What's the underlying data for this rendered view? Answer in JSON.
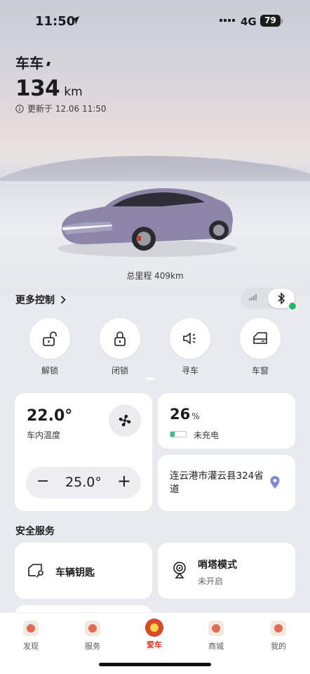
{
  "status_bar": {
    "time": "11:50",
    "network": "4G",
    "battery": "79"
  },
  "vehicle": {
    "name": "车车",
    "range_value": "134",
    "range_unit": "km",
    "updated": "更新于 12.06 11:50",
    "odometer": "总里程 409km"
  },
  "more_controls": {
    "label": "更多控制"
  },
  "quick_controls": [
    {
      "label": "解锁",
      "icon": "unlock-icon"
    },
    {
      "label": "闭锁",
      "icon": "lock-icon"
    },
    {
      "label": "寻车",
      "icon": "horn-icon"
    },
    {
      "label": "车窗",
      "icon": "window-icon"
    }
  ],
  "climate": {
    "inside_temp": "22.0°",
    "inside_label": "车内温度",
    "set_temp": "25.0°"
  },
  "battery_card": {
    "percent": "26",
    "unit": "%",
    "level": 0.26,
    "status": "未充电",
    "accent": "#2fc38a"
  },
  "location_card": {
    "address": "连云港市灌云县324省道"
  },
  "safety": {
    "title": "安全服务",
    "key_label": "车辆钥匙",
    "sentry_label": "哨塔模式",
    "sentry_status": "未开启"
  },
  "tabs": [
    {
      "label": "发现"
    },
    {
      "label": "服务"
    },
    {
      "label": "爱车",
      "active": true
    },
    {
      "label": "商城"
    },
    {
      "label": "我的"
    }
  ],
  "colors": {
    "brand_red": "#d23a1e",
    "connected_green": "#27b36b"
  }
}
